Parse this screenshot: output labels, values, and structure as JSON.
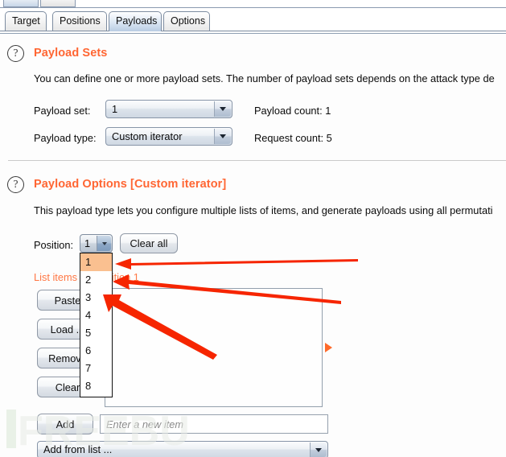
{
  "window": {
    "tabs": [
      {
        "label": "Target",
        "active": false
      },
      {
        "label": "Positions",
        "active": false
      },
      {
        "label": "Payloads",
        "active": true
      },
      {
        "label": "Options",
        "active": false
      }
    ]
  },
  "payload_sets": {
    "help_glyph": "?",
    "title": "Payload Sets",
    "description": "You can define one or more payload sets. The number of payload sets depends on the attack type de",
    "payload_set_label": "Payload set:",
    "payload_set_value": "1",
    "payload_type_label": "Payload type:",
    "payload_type_value": "Custom iterator",
    "payload_count_label": "Payload count:  1",
    "request_count_label": "Request count:  5"
  },
  "payload_options": {
    "help_glyph": "?",
    "title": "Payload Options [Custom iterator]",
    "description": "This payload type lets you configure multiple lists of items, and generate payloads using all permutati",
    "position_label": "Position:",
    "position_value": "1",
    "clear_all_label": "Clear all",
    "list_items_label": "List items for position 1",
    "buttons": [
      {
        "label": "Paste"
      },
      {
        "label": "Load ..."
      },
      {
        "label": "Remove"
      },
      {
        "label": "Clear"
      }
    ],
    "add_label": "Add",
    "new_item_placeholder": "Enter a new item",
    "add_from_list_label": "Add from list ..."
  },
  "position_dropdown": {
    "options": [
      "1",
      "2",
      "3",
      "4",
      "5",
      "6",
      "7",
      "8"
    ],
    "selected": "1"
  },
  "colors": {
    "accent_orange": "#ff6633",
    "label_orange": "#ff7744",
    "highlight_peach": "#fac090",
    "annotation_red": "#f62500",
    "marker_orange": "#ff6a2a",
    "tab_active": "#b9cde3",
    "watermark_green": "#d9e8d6"
  },
  "watermark": {
    "text": "FREEBUF"
  }
}
